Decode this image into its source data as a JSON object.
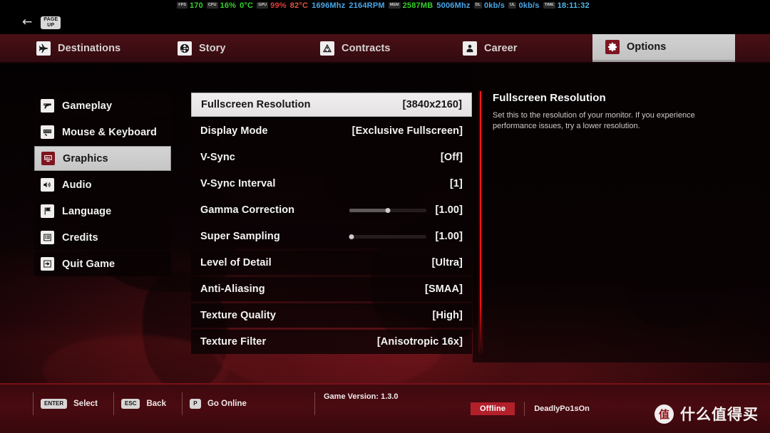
{
  "hw_overlay": {
    "items": [
      {
        "chip": "FPS",
        "value": "170",
        "color": "g"
      },
      {
        "chip": "CPU",
        "value": "16%",
        "color": "g"
      },
      {
        "chip": "",
        "value": "0°C",
        "color": "g"
      },
      {
        "chip": "GPU",
        "value": "99%",
        "color": "r"
      },
      {
        "chip": "",
        "value": "82°C",
        "color": "o"
      },
      {
        "chip": "",
        "value": "1696Mhz",
        "color": "b"
      },
      {
        "chip": "",
        "value": "2164RPM",
        "color": "b"
      },
      {
        "chip": "MEM",
        "value": "2587MB",
        "color": "g"
      },
      {
        "chip": "",
        "value": "5006Mhz",
        "color": "b"
      },
      {
        "chip": "DL",
        "value": "0kb/s",
        "color": "b"
      },
      {
        "chip": "UL",
        "value": "0kb/s",
        "color": "b"
      },
      {
        "chip": "TIME",
        "value": "18:11:32",
        "color": "c"
      }
    ]
  },
  "back_row": {
    "arrow": "←",
    "key_line1": "PAGE",
    "key_line2": "UP"
  },
  "navbar": {
    "items": [
      {
        "label": "Destinations",
        "icon": "airplane-icon",
        "active": false
      },
      {
        "label": "Story",
        "icon": "globe-icon",
        "active": false
      },
      {
        "label": "Contracts",
        "icon": "biohazard-icon",
        "active": false
      },
      {
        "label": "Career",
        "icon": "person-icon",
        "active": false
      },
      {
        "label": "Options",
        "icon": "gear-icon",
        "active": true
      }
    ]
  },
  "sidebar": {
    "items": [
      {
        "label": "Gameplay",
        "icon": "pistol-icon",
        "active": false
      },
      {
        "label": "Mouse & Keyboard",
        "icon": "keyboard-icon",
        "active": false
      },
      {
        "label": "Graphics",
        "icon": "monitor-icon",
        "active": true
      },
      {
        "label": "Audio",
        "icon": "speaker-icon",
        "active": false
      },
      {
        "label": "Language",
        "icon": "flag-icon",
        "active": false
      },
      {
        "label": "Credits",
        "icon": "list-icon",
        "active": false
      },
      {
        "label": "Quit Game",
        "icon": "exit-icon",
        "active": false
      }
    ]
  },
  "settings": {
    "rows": [
      {
        "label": "Fullscreen Resolution",
        "value": "[3840x2160]",
        "selected": true,
        "slider": null
      },
      {
        "label": "Display Mode",
        "value": "[Exclusive Fullscreen]",
        "selected": false,
        "slider": null
      },
      {
        "label": "V-Sync",
        "value": "[Off]",
        "selected": false,
        "slider": null
      },
      {
        "label": "V-Sync Interval",
        "value": "[1]",
        "selected": false,
        "slider": null
      },
      {
        "label": "Gamma Correction",
        "value": "[1.00]",
        "selected": false,
        "slider": {
          "percent": 50
        }
      },
      {
        "label": "Super Sampling",
        "value": "[1.00]",
        "selected": false,
        "slider": {
          "percent": 3
        }
      },
      {
        "label": "Level of Detail",
        "value": "[Ultra]",
        "selected": false,
        "slider": null
      },
      {
        "label": "Anti-Aliasing",
        "value": "[SMAA]",
        "selected": false,
        "slider": null
      },
      {
        "label": "Texture Quality",
        "value": "[High]",
        "selected": false,
        "slider": null
      },
      {
        "label": "Texture Filter",
        "value": "[Anisotropic 16x]",
        "selected": false,
        "slider": null
      }
    ]
  },
  "description": {
    "title": "Fullscreen Resolution",
    "body": "Set this to the resolution of your monitor. If you experience performance issues, try a lower resolution."
  },
  "bottom_bar": {
    "hints": [
      {
        "key": "ENTER",
        "label": "Select"
      },
      {
        "key": "ESC",
        "label": "Back"
      },
      {
        "key": "P",
        "label": "Go Online"
      }
    ],
    "game_version": "Game Version: 1.3.0",
    "online_status": "Offline",
    "username": "DeadlyPo1sOn"
  },
  "watermark": {
    "logo": "值",
    "text": "什么值得买"
  },
  "colors": {
    "accent_red": "#b2202a",
    "divider_red": "#ff1a1a",
    "nav_bg": "#3d0d12",
    "panel_bg": "#0a0304",
    "selected_bg": "#ededed"
  }
}
